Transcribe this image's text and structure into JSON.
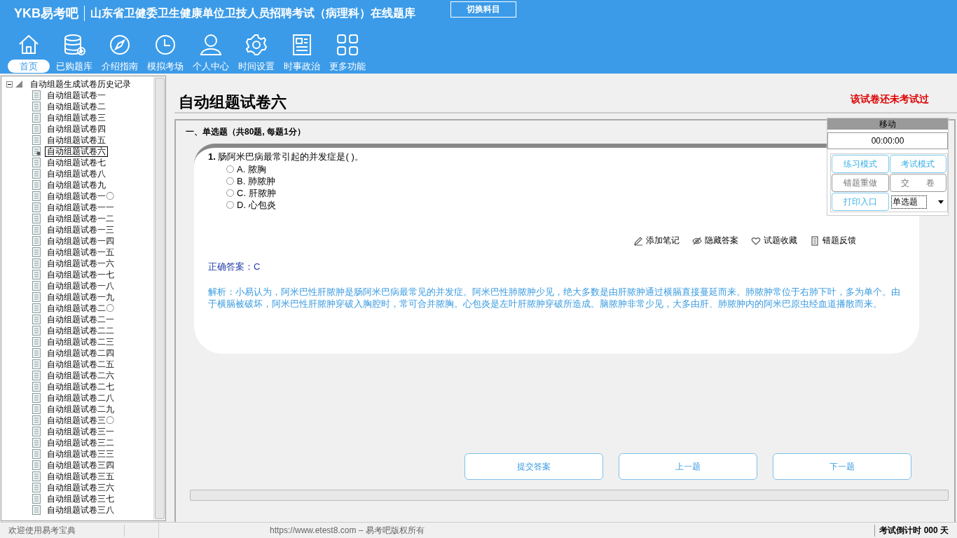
{
  "header": {
    "logo": "YKB易考吧",
    "title": "山东省卫健委卫生健康单位卫技人员招聘考试（病理科）在线题库",
    "switch_button": "切换科目"
  },
  "nav": [
    {
      "label": "首页",
      "kind": "home",
      "selected": true
    },
    {
      "label": "已购题库",
      "kind": "database",
      "selected": false
    },
    {
      "label": "介绍指南",
      "kind": "compass",
      "selected": false
    },
    {
      "label": "模拟考场",
      "kind": "clock",
      "selected": false
    },
    {
      "label": "个人中心",
      "kind": "user",
      "selected": false
    },
    {
      "label": "时间设置",
      "kind": "gear",
      "selected": false
    },
    {
      "label": "时事政治",
      "kind": "news",
      "selected": false
    },
    {
      "label": "更多功能",
      "kind": "grid",
      "selected": false
    }
  ],
  "tree": {
    "label": "自动组题生成试卷历史记录",
    "expanded": true,
    "children": [
      {
        "label": "自动组题试卷一",
        "selected": false
      },
      {
        "label": "自动组题试卷二",
        "selected": false
      },
      {
        "label": "自动组题试卷三",
        "selected": false
      },
      {
        "label": "自动组题试卷四",
        "selected": false
      },
      {
        "label": "自动组题试卷五",
        "selected": false
      },
      {
        "label": "自动组题试卷六",
        "selected": true
      },
      {
        "label": "自动组题试卷七",
        "selected": false
      },
      {
        "label": "自动组题试卷八",
        "selected": false
      },
      {
        "label": "自动组题试卷九",
        "selected": false
      },
      {
        "label": "自动组题试卷一〇",
        "selected": false
      },
      {
        "label": "自动组题试卷一一",
        "selected": false
      },
      {
        "label": "自动组题试卷一二",
        "selected": false
      },
      {
        "label": "自动组题试卷一三",
        "selected": false
      },
      {
        "label": "自动组题试卷一四",
        "selected": false
      },
      {
        "label": "自动组题试卷一五",
        "selected": false
      },
      {
        "label": "自动组题试卷一六",
        "selected": false
      },
      {
        "label": "自动组题试卷一七",
        "selected": false
      },
      {
        "label": "自动组题试卷一八",
        "selected": false
      },
      {
        "label": "自动组题试卷一九",
        "selected": false
      },
      {
        "label": "自动组题试卷二〇",
        "selected": false
      },
      {
        "label": "自动组题试卷二一",
        "selected": false
      },
      {
        "label": "自动组题试卷二二",
        "selected": false
      },
      {
        "label": "自动组题试卷二三",
        "selected": false
      },
      {
        "label": "自动组题试卷二四",
        "selected": false
      },
      {
        "label": "自动组题试卷二五",
        "selected": false
      },
      {
        "label": "自动组题试卷二六",
        "selected": false
      },
      {
        "label": "自动组题试卷二七",
        "selected": false
      },
      {
        "label": "自动组题试卷二八",
        "selected": false
      },
      {
        "label": "自动组题试卷二九",
        "selected": false
      },
      {
        "label": "自动组题试卷三〇",
        "selected": false
      },
      {
        "label": "自动组题试卷三一",
        "selected": false
      },
      {
        "label": "自动组题试卷三二",
        "selected": false
      },
      {
        "label": "自动组题试卷三三",
        "selected": false
      },
      {
        "label": "自动组题试卷三四",
        "selected": false
      },
      {
        "label": "自动组题试卷三五",
        "selected": false
      },
      {
        "label": "自动组题试卷三六",
        "selected": false
      },
      {
        "label": "自动组题试卷三七",
        "selected": false
      },
      {
        "label": "自动组题试卷三八",
        "selected": false
      }
    ]
  },
  "paper": {
    "title": "自动组题试卷六",
    "status": "该试卷还未考试过",
    "section": "一、单选题（共80题, 每题1分）"
  },
  "question": {
    "number": "1.",
    "text": "肠阿米巴病最常引起的并发症是( )。",
    "options": [
      {
        "label": "A. 脓胸",
        "selected": false
      },
      {
        "label": "B. 肺脓肿",
        "selected": false
      },
      {
        "label": "C. 肝脓肿",
        "selected": false
      },
      {
        "label": "D. 心包炎",
        "selected": false
      }
    ],
    "actions": [
      {
        "label": "添加笔记",
        "kind": "pencil"
      },
      {
        "label": "隐藏答案",
        "kind": "eye"
      },
      {
        "label": "试题收藏",
        "kind": "heart"
      },
      {
        "label": "错题反馈",
        "kind": "doc"
      }
    ],
    "answer": "正确答案：C",
    "analysis": "解析：小易认为，阿米巴性肝脓肿是肠阿米巴病最常见的并发症。阿米巴性肺脓肿少见，绝大多数是由肝脓肿通过横膈直接蔓延而来。肺脓肿常位于右肺下叶，多为单个。由于横膈被破坏，阿米巴性肝脓肿穿破入胸腔时，常可合并脓胸。心包炎是左叶肝脓肿穿破所造成。脑脓肿非常少见，大多由肝、肺脓肿内的阿米巴原虫经血道播散而来。"
  },
  "bottom_buttons": [
    "提交答案",
    "上一题",
    "下一题"
  ],
  "panel": {
    "title": "移动",
    "timer": "00:00:00",
    "buttons": [
      {
        "label": "练习模式",
        "kind": "blue"
      },
      {
        "label": "考试模式",
        "kind": "blue"
      },
      {
        "label": "错题重做",
        "kind": "gray"
      },
      {
        "label": "交　　卷",
        "kind": "gray"
      },
      {
        "label": "打印入口",
        "kind": "blue"
      }
    ],
    "select": "单选题"
  },
  "status_bar": {
    "welcome": "欢迎使用易考宝典",
    "copyright": "https://www.etest8.com – 易考吧版权所有",
    "countdown": "考试倒计时 000 天"
  }
}
